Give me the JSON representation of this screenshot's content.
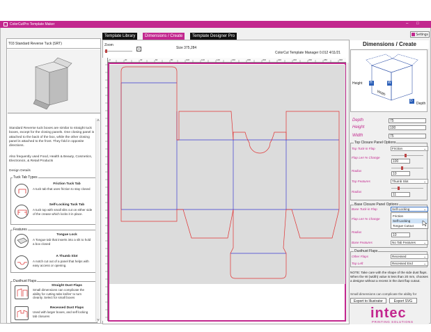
{
  "app": {
    "title": "ColorCutPro Template Maker",
    "window_controls": [
      "–",
      "□"
    ]
  },
  "tabs": [
    {
      "label": "Template Library",
      "active": false
    },
    {
      "label": "Dimensions / Create",
      "active": true
    },
    {
      "label": "Template Designer Pro",
      "active": false
    }
  ],
  "left": {
    "template_name": "T03 Standard Reverse Tuck (SRT)",
    "description": "Standard Reverse tuck boxes are similar to straight tuck boxes, except for the closing panels. One closing panel is attached to the back of the box, while the other closing panel is attached to the front. They fold in opposite directions.",
    "uses": "Also frequently used Food, Health & Beauty, Cosmetics, Electronics, & Retail Products",
    "design_details": "Design Details",
    "groups": {
      "tuck_tab_types": {
        "label": "Tuck Tab Types",
        "items": [
          {
            "title": "Friction Tuck Tab",
            "desc": "A tuck tab that uses friction to stay closed"
          },
          {
            "title": "Self-Locking Tuck Tab",
            "desc": "A tuck top with small slits cut on either side of the crease which locks it in place."
          }
        ]
      },
      "features": {
        "label": "Features",
        "items": [
          {
            "title": "Tongue Lock",
            "desc": "A Tongue tab that inserts into a slit to hold a box closed"
          },
          {
            "title": "A Thumb Slot",
            "desc": "A notch cut out of a panel that helps with easy access or opening."
          }
        ]
      },
      "dusthust_flaps": {
        "label": "Dusthust Flaps",
        "items": [
          {
            "title": "Straight Dust Flaps",
            "desc": "Small dimensions can complicate the ability for cutting tabs knifes' to turn cleanly. Select for small boxes"
          },
          {
            "title": "Recessed Dust Flaps",
            "desc": "Used with larger boxes, and self locking tab closures"
          }
        ]
      }
    }
  },
  "canvas": {
    "zoom_label": "Zoom",
    "size_text": "Size 375,284",
    "manager_text": "ColorCut Template Manager 0.012 4/11/21",
    "ruler_top_ticks": [
      "0",
      "10",
      "20",
      "30",
      "40",
      "50",
      "60",
      "70",
      "80",
      "90",
      "100",
      "110",
      "120",
      "130",
      "140",
      "150",
      "160",
      "170",
      "180",
      "190",
      "200",
      "210",
      "220",
      "230",
      "240",
      "250",
      "260",
      "270",
      "280",
      "290",
      "300"
    ]
  },
  "right": {
    "settings_label": "Settings",
    "title": "Dimensions / Create",
    "diagram_labels": {
      "height": "Height",
      "h": "H",
      "w": "W",
      "width": "Width",
      "d": "D",
      "depth": "Depth"
    },
    "depth": {
      "label": "Depth",
      "value": "75"
    },
    "height": {
      "label": "Height",
      "value": "100"
    },
    "width": {
      "label": "Width",
      "value": "75"
    },
    "top_closure": {
      "label": "Top Closure Panel Options",
      "tuck_in_flap_label": "Top Tuck-in Flap",
      "tuck_in_flap_value": "Friction",
      "flap_len_label": "Flap Len % Change",
      "flap_len_value": "100",
      "radius_label": "Radius",
      "radius_value": "10",
      "top_features_label": "Top Features",
      "top_features_value": "Thumb Slot",
      "radius2_label": "Radius",
      "radius2_value": "11"
    },
    "base_closure": {
      "label": "Base Closure Panel Options",
      "tuck_in_flap_label": "Base Tuck-in Flap",
      "tuck_in_flap_value": "Self-Locking",
      "flap_len_label": "Flap Len % Change",
      "radius_label": "Radius",
      "radius_value": "10",
      "base_features_label": "Base Features",
      "base_features_value": "No Tab Features",
      "dropdown_options": [
        "Friction",
        "Self-Locking",
        "Tongue Cutout"
      ],
      "dropdown_highlight": "Self-Locking"
    },
    "dust_flaps": {
      "label": "Dusthust Flaps",
      "other_flaps_label": "Other Flaps",
      "other_flaps_value": "Recessed",
      "top_left_label": "Top Left",
      "top_left_value": "Recessed End"
    },
    "note": "NOTE: Take care with the shape of the side dust flaps. When the W (width) value is less than 20 mm, chooses a designe without a recess in the dust flap cutout.",
    "note2": "Small dimensions can complicate the ability for",
    "export_illustrator": "Export to Illustrator",
    "export_svg": "Export SVG",
    "brand": "intec",
    "brand_sub": "PRINTING SOLUTIONS"
  },
  "colors": {
    "accent": "#c2278e",
    "cut_line": "#e03030",
    "fold_line": "#3a3ad0"
  }
}
